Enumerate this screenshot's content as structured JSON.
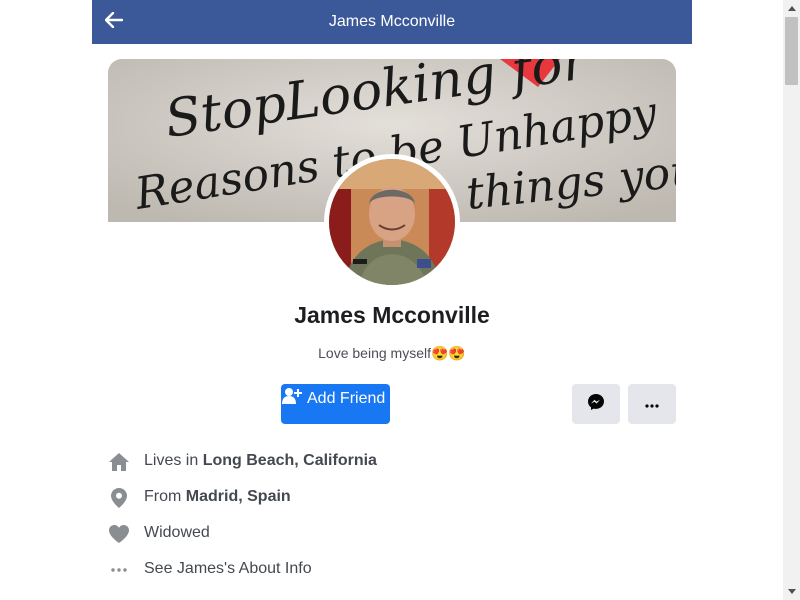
{
  "header": {
    "title": "James Mcconville",
    "back_icon": "arrow-left-icon",
    "background_color": "#3b5998"
  },
  "cover": {
    "lines": [
      "StopLooking for",
      "Reasons to be Unhappy",
      "things you"
    ]
  },
  "profile": {
    "name": "James Mcconville",
    "bio": "Love being myself😍😍"
  },
  "actions": {
    "add_friend_label": "Add Friend",
    "add_friend_icon": "add-friend-icon",
    "messenger_icon": "messenger-icon",
    "more_icon": "more-horizontal-icon",
    "accent_color": "#1877f2"
  },
  "info": {
    "lives_in_prefix": "Lives in",
    "lives_in_value": "Long Beach, California",
    "from_prefix": "From",
    "from_value": "Madrid, Spain",
    "relationship": "Widowed",
    "about_link": "See James's About Info"
  }
}
